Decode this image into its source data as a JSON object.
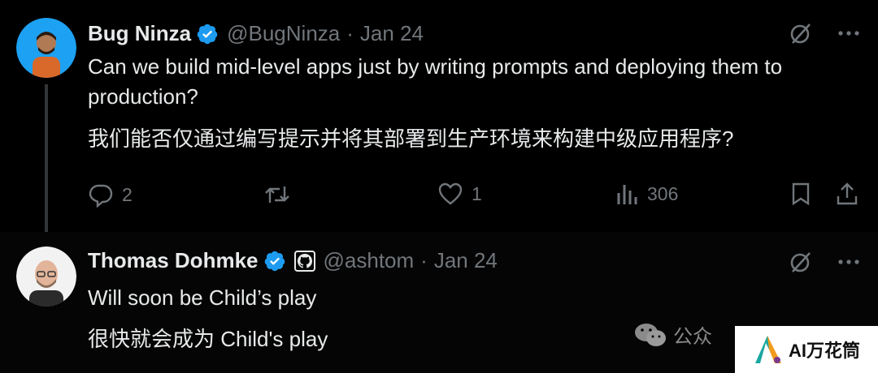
{
  "tweets": [
    {
      "author_name": "Bug Ninza",
      "handle": "@BugNinza",
      "date": "Jan 24",
      "text_en": "Can we build mid-level apps just by writing prompts and deploying them to production?",
      "text_zh": "我们能否仅通过编写提示并将其部署到生产环境来构建中级应用程序?",
      "replies": "2",
      "retweets": "",
      "likes": "1",
      "views": "306"
    },
    {
      "author_name": "Thomas Dohmke",
      "handle": "@ashtom",
      "date": "Jan 24",
      "text_en": "Will soon be Child’s play",
      "text_zh": "很快就会成为 Child's play"
    }
  ],
  "separator": "·",
  "overlay": {
    "wechat_label": "公众",
    "brand_text": "AI万花筒"
  },
  "colors": {
    "background": "#000000",
    "text": "#e7e9ea",
    "muted": "#71767b",
    "verified": "#1d9bf0"
  },
  "icons": [
    "verified-badge-icon",
    "grok-icon",
    "more-icon",
    "reply-icon",
    "retweet-icon",
    "like-icon",
    "views-icon",
    "bookmark-icon",
    "share-icon",
    "github-icon",
    "wechat-icon"
  ]
}
